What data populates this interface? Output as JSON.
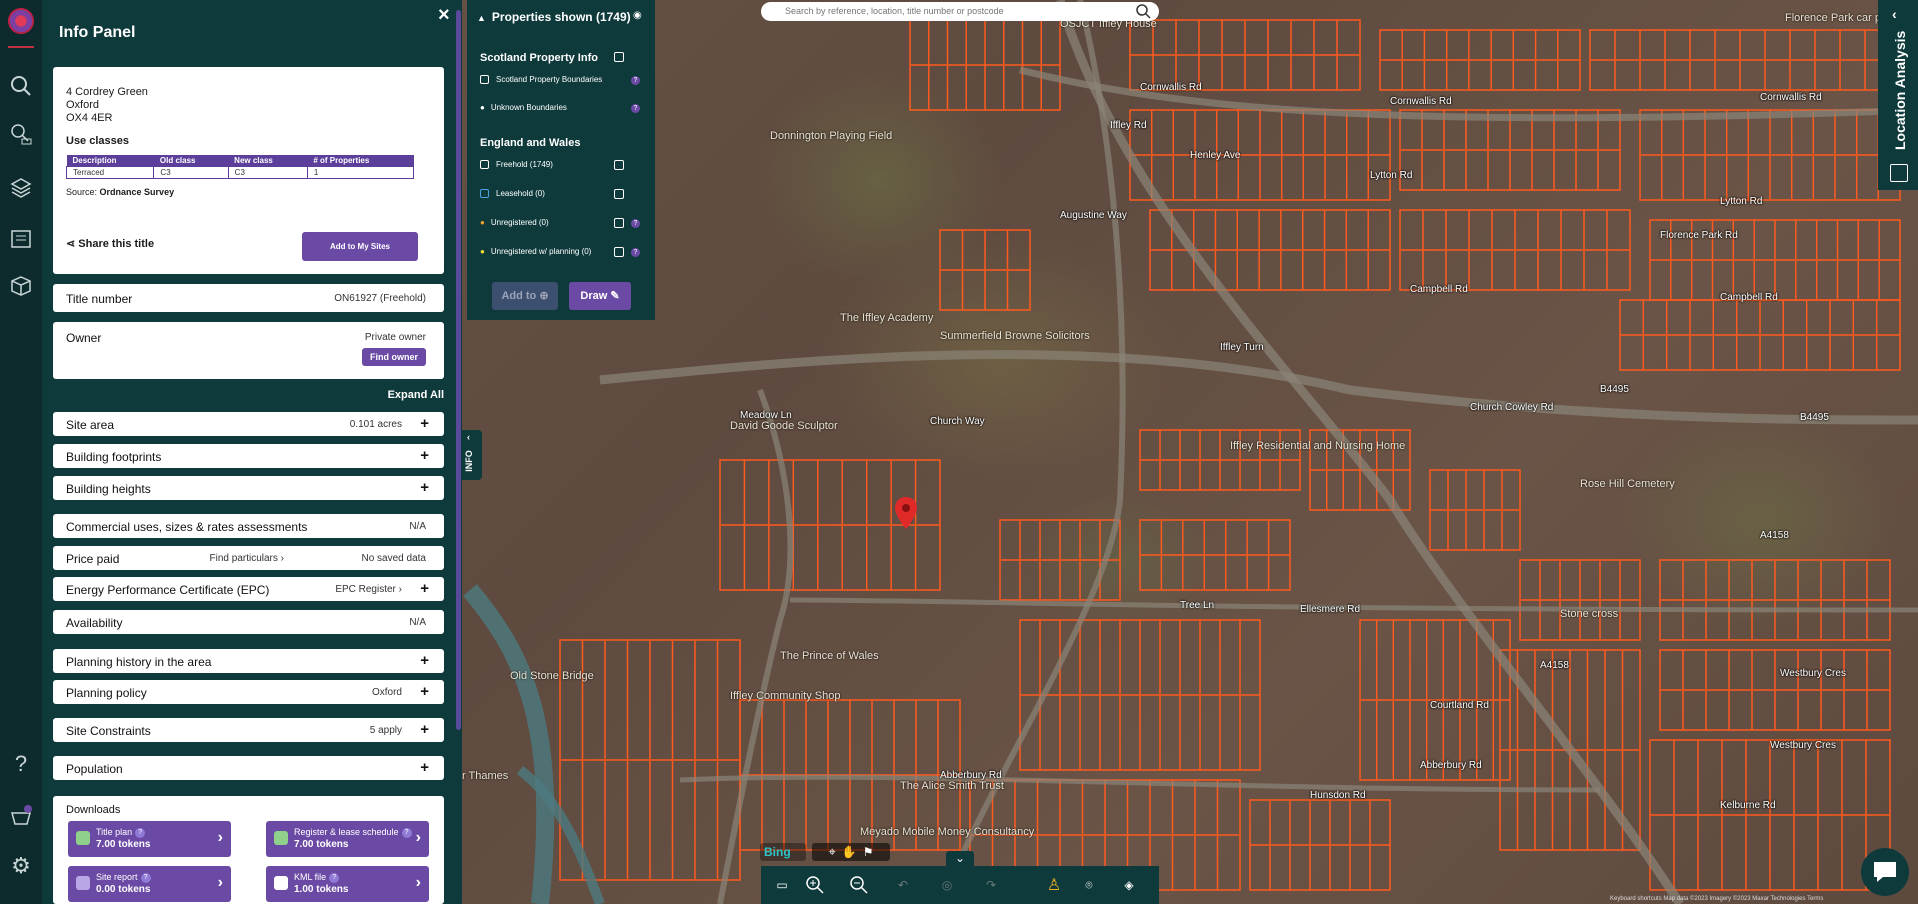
{
  "panel": {
    "title": "Info Panel",
    "close": "×",
    "address": {
      "line1": "4 Cordrey Green",
      "line2": "Oxford",
      "line3": "OX4 4ER"
    },
    "use_classes": {
      "heading": "Use classes",
      "columns": [
        "Description",
        "Old class",
        "New class",
        "# of Properties"
      ],
      "row": [
        "Terraced",
        "C3",
        "C3",
        "1"
      ],
      "source_prefix": "Source:",
      "source": "Ordnance Survey"
    },
    "share": "Share this title",
    "add_sites": "Add to My Sites",
    "title_number": {
      "label": "Title number",
      "value": "ON61927 (Freehold)"
    },
    "owner": {
      "label": "Owner",
      "value": "Private owner",
      "button": "Find owner"
    },
    "expand_all": "Expand All",
    "rows": [
      {
        "label": "Site area",
        "value": "0.101 acres",
        "plus": "+"
      },
      {
        "label": "Building footprints",
        "value": "",
        "plus": "+"
      },
      {
        "label": "Building heights",
        "value": "",
        "plus": "+"
      },
      {
        "label": "Commercial uses, sizes & rates assessments",
        "value": "N/A",
        "plus": ""
      },
      {
        "label": "Price paid",
        "link": "Find particulars ›",
        "value": "No saved data",
        "plus": ""
      },
      {
        "label": "Energy Performance Certificate (EPC)",
        "link": "EPC Register ›",
        "value": "",
        "plus": "+"
      },
      {
        "label": "Availability",
        "value": "N/A",
        "plus": ""
      },
      {
        "label": "Planning history in the area",
        "value": "",
        "plus": "+"
      },
      {
        "label": "Planning policy",
        "value": "Oxford",
        "plus": "+"
      },
      {
        "label": "Site Constraints",
        "value": "5 apply",
        "plus": "+"
      },
      {
        "label": "Population",
        "value": "",
        "plus": "+"
      }
    ],
    "downloads": {
      "heading": "Downloads",
      "items": [
        {
          "title": "Title plan",
          "tokens": "7.00 tokens"
        },
        {
          "title": "Register & lease schedule",
          "tokens": "7.00 tokens"
        },
        {
          "title": "Site report",
          "tokens": "0.00 tokens"
        },
        {
          "title": "KML file",
          "tokens": "1.00 tokens"
        }
      ]
    },
    "info_tab": "INFO"
  },
  "layers": {
    "header": "Properties shown (1749)",
    "scotland": {
      "heading": "Scotland Property Info",
      "items": [
        "Scotland Property Boundaries",
        "Unknown Boundaries"
      ]
    },
    "england": {
      "heading": "England and Wales",
      "items": [
        "Freehold (1749)",
        "Leasehold (0)",
        "Unregistered (0)",
        "Unregistered w/ planning (0)"
      ]
    },
    "add_to": "Add to",
    "draw": "Draw"
  },
  "search": {
    "placeholder": "Search by reference, location, title number or postcode"
  },
  "analysis": {
    "label": "Location Analysis"
  },
  "map_labels": {
    "roads": [
      "Cornwallis Rd",
      "Cornwallis Rd",
      "Cornwallis Rd",
      "Lytton Rd",
      "Lytton Rd",
      "Campbell Rd",
      "Campbell Rd",
      "Church Cowley Rd",
      "B4495",
      "B4495",
      "Iffley Turn",
      "Henley Ave",
      "Iffley Rd",
      "Church Way",
      "Meadow Ln",
      "Tree Ln",
      "Ellesmere Rd",
      "Abberbury Rd",
      "Abberbury Rd",
      "Hunsdon Rd",
      "Courtland Rd",
      "Westbury Cres",
      "Westbury Cres",
      "Kelburne Rd",
      "A4158",
      "A4158",
      "Florence Park Rd",
      "Augustine Way"
    ],
    "places": [
      "Donnington Playing Field",
      "The Iffley Academy",
      "Summerfield Browne Solicitors",
      "David Goode Sculptor",
      "Iffley Residential and Nursing Home",
      "Rose Hill Cemetery",
      "Stone cross",
      "Old Stone Bridge",
      "The Prince of Wales",
      "Iffley Community Shop",
      "The Alice Smith Trust",
      "Florence Park car park",
      "OSJCT Iffley House",
      "Meyado Mobile Money Consultancy",
      "River Thames"
    ]
  },
  "bing": "Bing",
  "attribution": "Keyboard shortcuts   Map data ©2023 Imagery ©2023 Maxar Technologies   Terms"
}
